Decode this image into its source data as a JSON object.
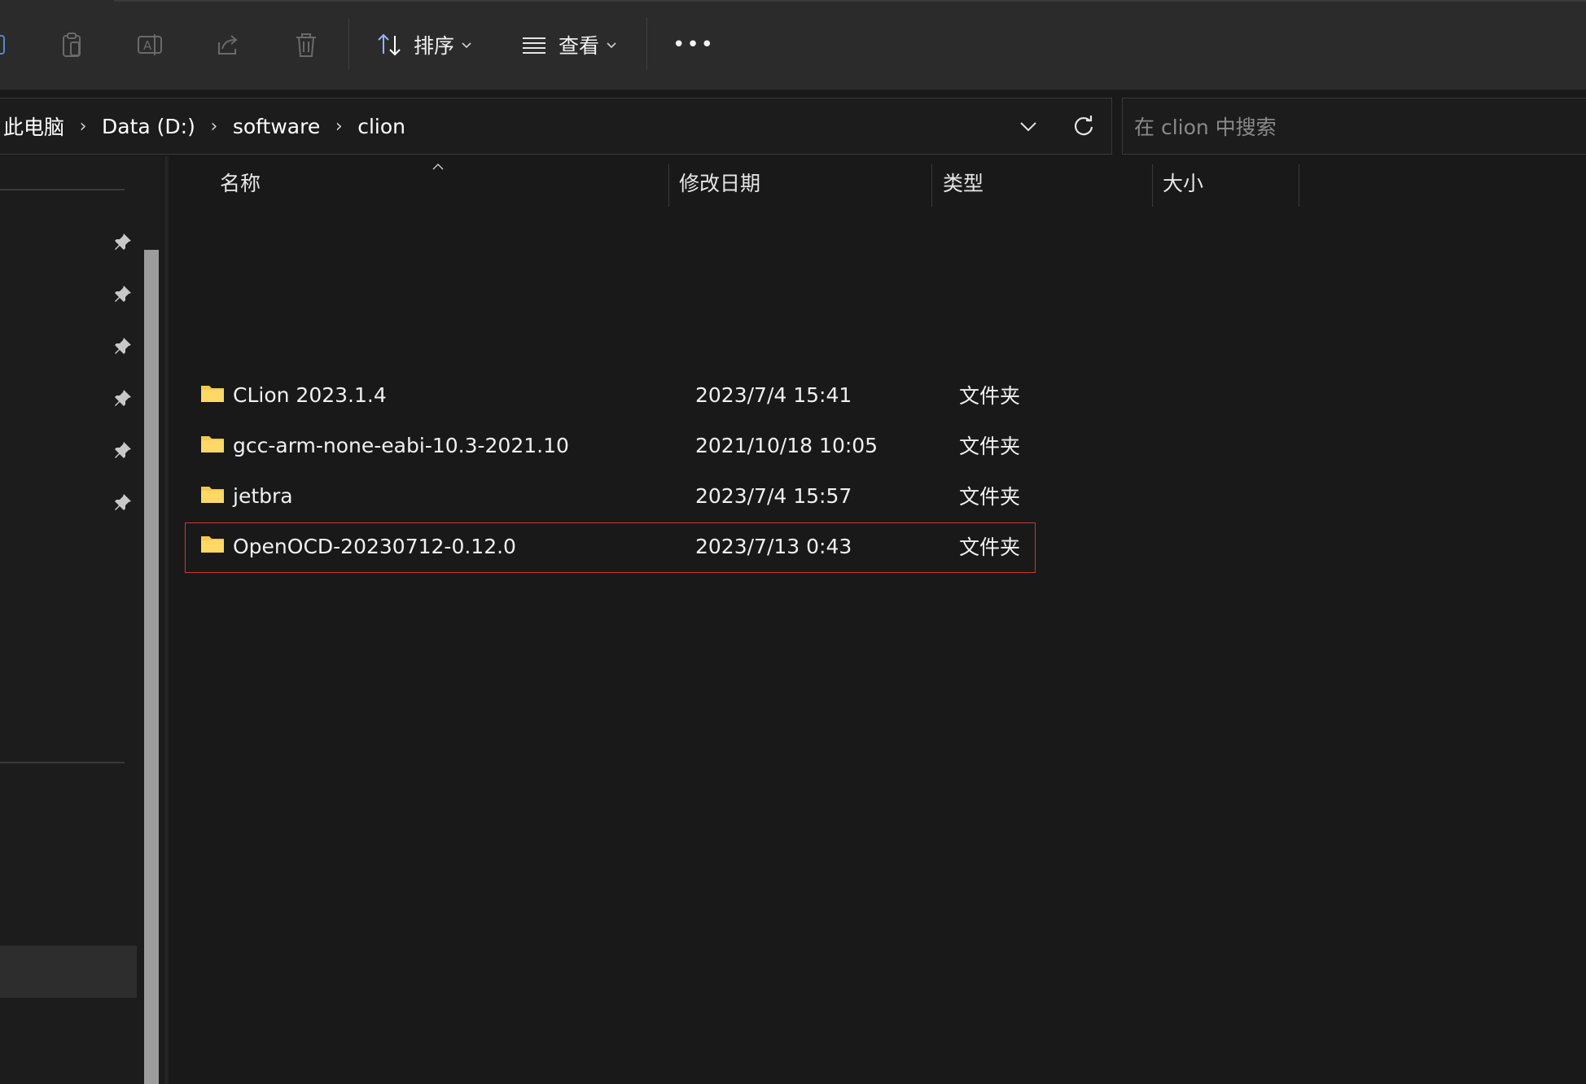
{
  "toolbar": {
    "icons": [
      "partial-icon",
      "paste-icon",
      "rename-icon",
      "share-icon",
      "delete-icon"
    ],
    "sort_label": "排序",
    "view_label": "查看",
    "more_label": "•••"
  },
  "address": {
    "breadcrumb": [
      "此电脑",
      "Data (D:)",
      "software",
      "clion"
    ],
    "separator": "›"
  },
  "search": {
    "placeholder": "在 clion 中搜索",
    "value": ""
  },
  "columns": {
    "name": "名称",
    "modified": "修改日期",
    "type": "类型",
    "size": "大小"
  },
  "files": [
    {
      "name": "CLion 2023.1.4",
      "modified": "2023/7/4 15:41",
      "type": "文件夹",
      "size": "",
      "selected": false
    },
    {
      "name": "gcc-arm-none-eabi-10.3-2021.10",
      "modified": "2021/10/18 10:05",
      "type": "文件夹",
      "size": "",
      "selected": false
    },
    {
      "name": "jetbra",
      "modified": "2023/7/4 15:57",
      "type": "文件夹",
      "size": "",
      "selected": false
    },
    {
      "name": "OpenOCD-20230712-0.12.0",
      "modified": "2023/7/13 0:43",
      "type": "文件夹",
      "size": "",
      "selected": true
    }
  ],
  "colors": {
    "background": "#191919",
    "toolbar": "#2b2b2b",
    "folder": "#f8c948",
    "highlight_border": "#d63333",
    "scrollbar_thumb": "#9c9c9c"
  }
}
